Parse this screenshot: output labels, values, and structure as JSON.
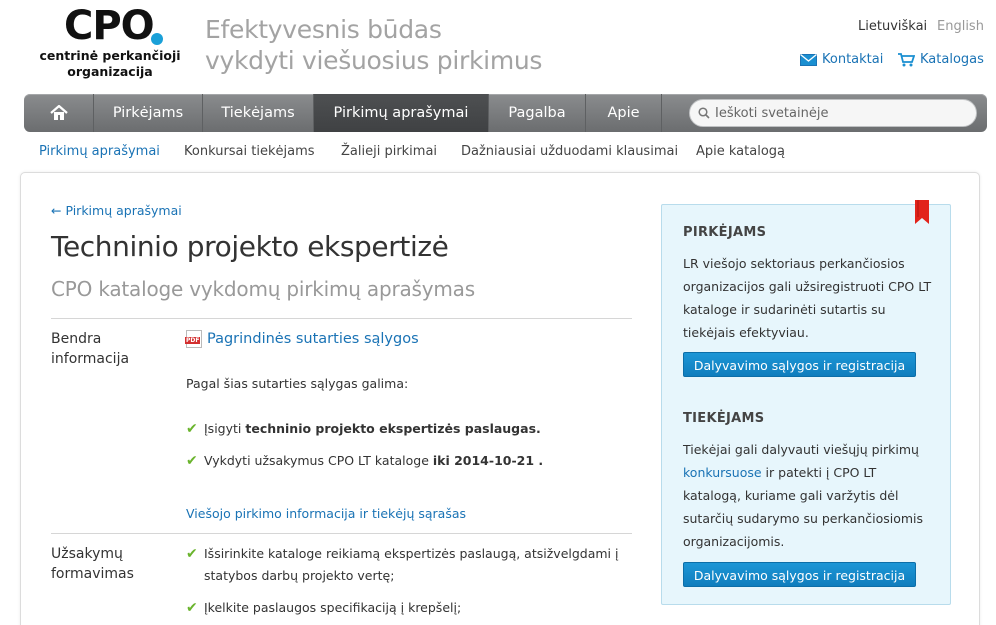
{
  "logo": {
    "main": "CPO",
    "sub_line1": "centrinė perkančioji",
    "sub_line2": "organizacija"
  },
  "tagline": {
    "line1": "Efektyvesnis būdas",
    "line2": "vykdyti viešuosius pirkimus"
  },
  "languages": [
    "Lietuviškai",
    "English"
  ],
  "top_links": {
    "contacts": "Kontaktai",
    "catalog": "Katalogas"
  },
  "nav": {
    "items": [
      "Pirkėjams",
      "Tiekėjams",
      "Pirkimų aprašymai",
      "Pagalba",
      "Apie"
    ],
    "active": "Pirkimų aprašymai"
  },
  "search": {
    "placeholder": "Ieškoti svetainėje"
  },
  "subnav": [
    "Pirkimų aprašymai",
    "Konkursai tiekėjams",
    "Žalieji pirkimai",
    "Dažniausiai užduodami klausimai",
    "Apie katalogą"
  ],
  "main": {
    "back_link": "← Pirkimų aprašymai",
    "title": "Techninio projekto ekspertizė",
    "subtitle": "CPO kataloge vykdomų pirkimų aprašymas",
    "general": {
      "label_line1": "Bendra",
      "label_line2": "informacija",
      "pdf_link": "Pagrindinės sutarties sąlygos",
      "intro": "Pagal šias sutarties sąlygas galima:",
      "item1_prefix": "Įsigyti ",
      "item1_bold": "techninio projekto ekspertizės paslaugas.",
      "item2_prefix": "Vykdyti užsakymus CPO LT kataloge ",
      "item2_bold": "iki 2014-10-21 .",
      "info_link": "Viešojo pirkimo informacija ir tiekėjų sąrašas"
    },
    "ordering": {
      "label_line1": "Užsakymų",
      "label_line2": "formavimas",
      "step1": "Išsirinkite kataloge reikiamą ekspertizės paslaugą, atsižvelgdami į statybos darbų projekto vertę;",
      "step2": "Įkelkite paslaugos specifikaciją į krepšelį;"
    }
  },
  "sidebar": {
    "buyers_title": "PIRKĖJAMS",
    "buyers_text": "LR viešojo sektoriaus perkančiosios organizacijos gali užsiregistruoti CPO LT kataloge ir sudarinėti sutartis su tiekėjais efektyviau.",
    "buyers_button": "Dalyvavimo sąlygos ir registracija",
    "suppliers_title": "TIEKĖJAMS",
    "suppliers_text_before": "Tiekėjai gali dalyvauti viešųjų pirkimų ",
    "suppliers_link": "konkursuose",
    "suppliers_text_after": " ir patekti į CPO LT katalogą, kuriame gali varžytis dėl sutarčių sudarymo su perkančiosiomis organizacijomis.",
    "suppliers_button": "Dalyvavimo sąlygos ir registracija"
  },
  "colors": {
    "accent": "#1a73b5",
    "button": "#1489cb",
    "sidebar_bg": "#e7f6fc",
    "check": "#6ab42d",
    "bookmark": "#e2231a"
  },
  "icons": [
    "home-icon",
    "search-icon",
    "mail-icon",
    "cart-icon",
    "pdf-icon",
    "check-icon",
    "bookmark-icon"
  ]
}
